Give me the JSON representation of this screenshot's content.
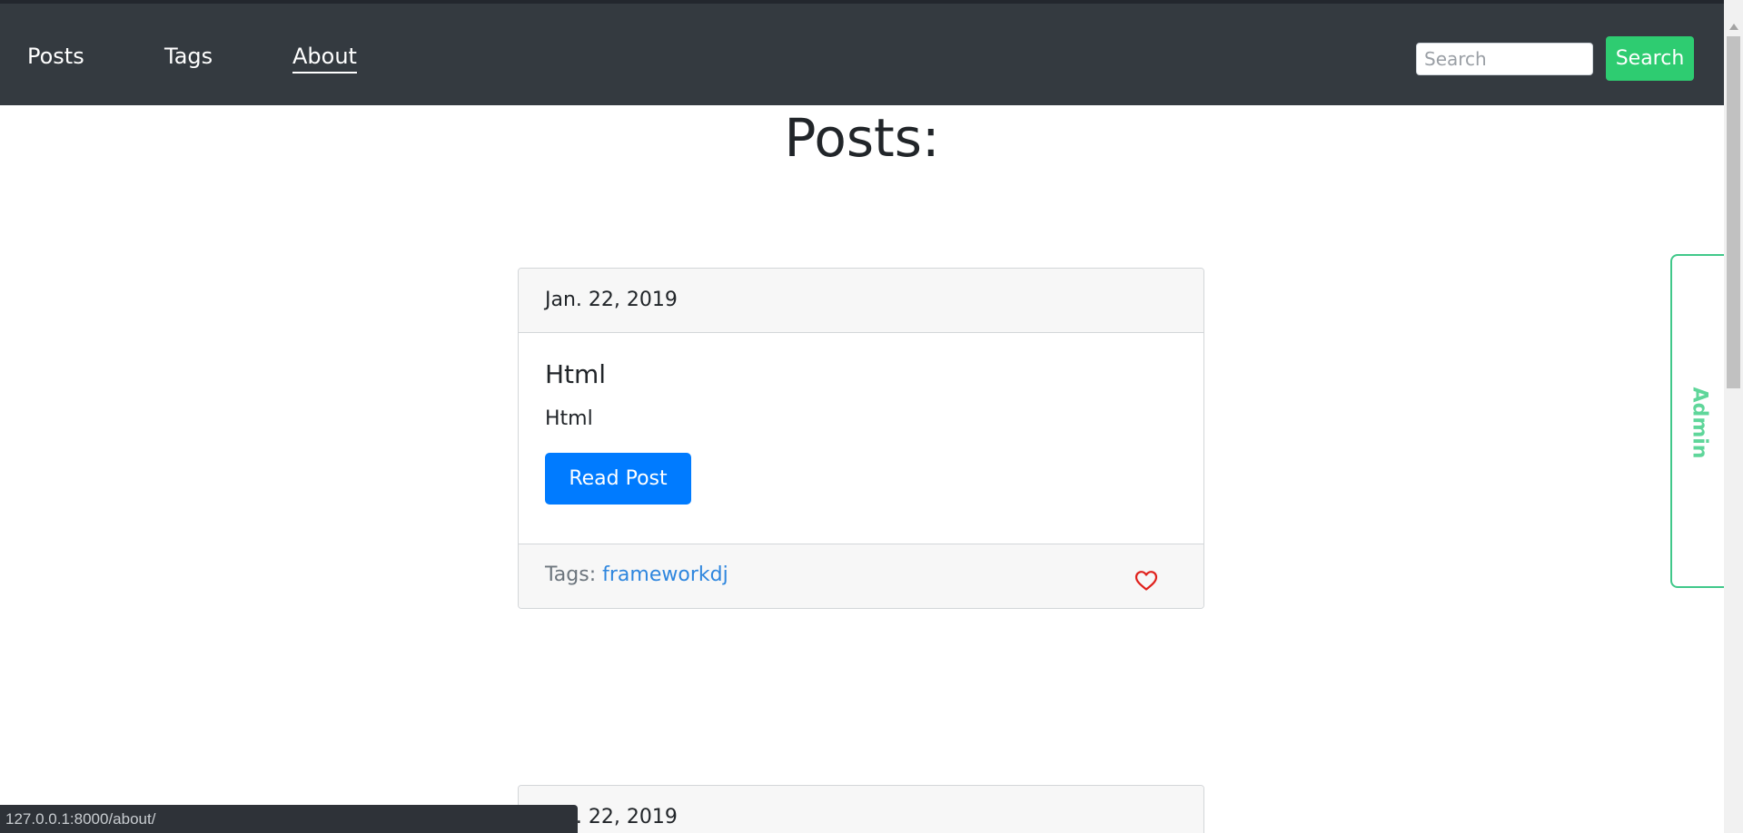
{
  "navbar": {
    "links": [
      {
        "label": "Posts"
      },
      {
        "label": "Tags"
      },
      {
        "label": "About",
        "active": true
      }
    ],
    "search": {
      "placeholder": "Search",
      "value": "",
      "button_label": "Search"
    }
  },
  "main": {
    "title": "Posts:",
    "posts": [
      {
        "date": "Jan. 22, 2019",
        "title": "Html",
        "text": "Html",
        "read_label": "Read Post",
        "tags_label": "Tags:",
        "tags": [
          "frameworkdj"
        ],
        "like_icon": "heart-outline-icon"
      },
      {
        "date": "Jan. 22, 2019"
      }
    ]
  },
  "admin_tab": {
    "label": "Admin"
  },
  "status_bar": {
    "url": "127.0.0.1:8000/about/"
  },
  "colors": {
    "navbar": "#343a40",
    "search_button": "#2ecc71",
    "primary_button": "#007bff",
    "tag_link": "#2e86de",
    "heart": "#e0201b",
    "admin_accent": "#40c88a"
  }
}
